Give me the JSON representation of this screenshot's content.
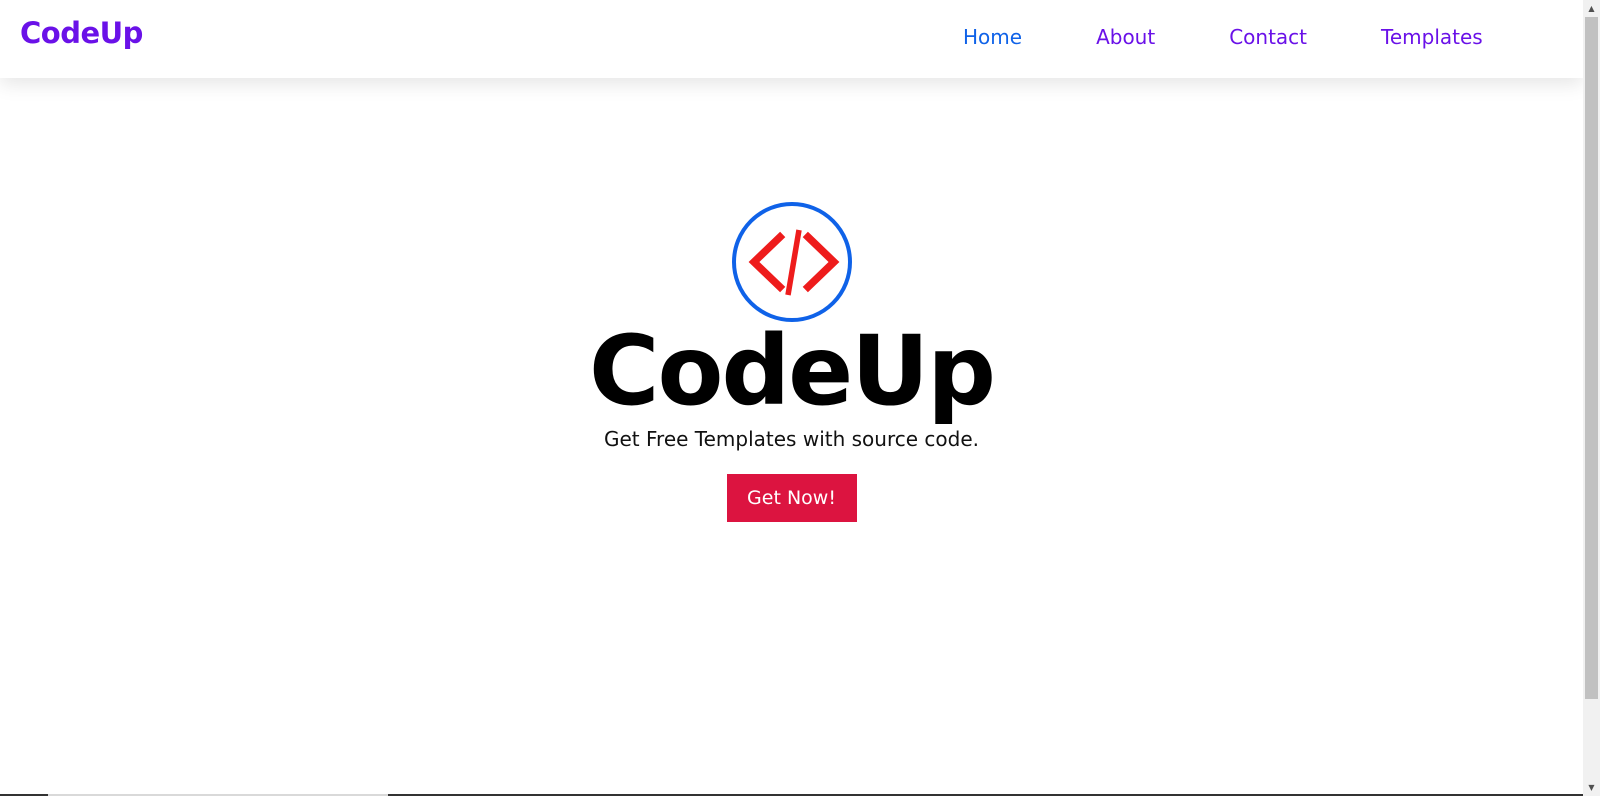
{
  "brand": {
    "name": "CodeUp",
    "color": "#6a11e8"
  },
  "nav": {
    "items": [
      {
        "label": "Home",
        "active": true,
        "color": "#0f62e8"
      },
      {
        "label": "About",
        "active": false,
        "color": "#6a11e8"
      },
      {
        "label": "Contact",
        "active": false,
        "color": "#6a11e8"
      },
      {
        "label": "Templates",
        "active": false,
        "color": "#6a11e8"
      }
    ]
  },
  "hero": {
    "icon": "code-brackets-icon",
    "icon_ring_color": "#0f62e8",
    "icon_glyph_color": "#ee1c1c",
    "title": "CodeUp",
    "subtitle": "Get Free Templates with source code.",
    "cta_label": "Get Now!",
    "cta_color": "#dc1440"
  },
  "scrollbar": {
    "up_icon": "scroll-up-arrow-icon",
    "down_icon": "scroll-down-arrow-icon"
  }
}
